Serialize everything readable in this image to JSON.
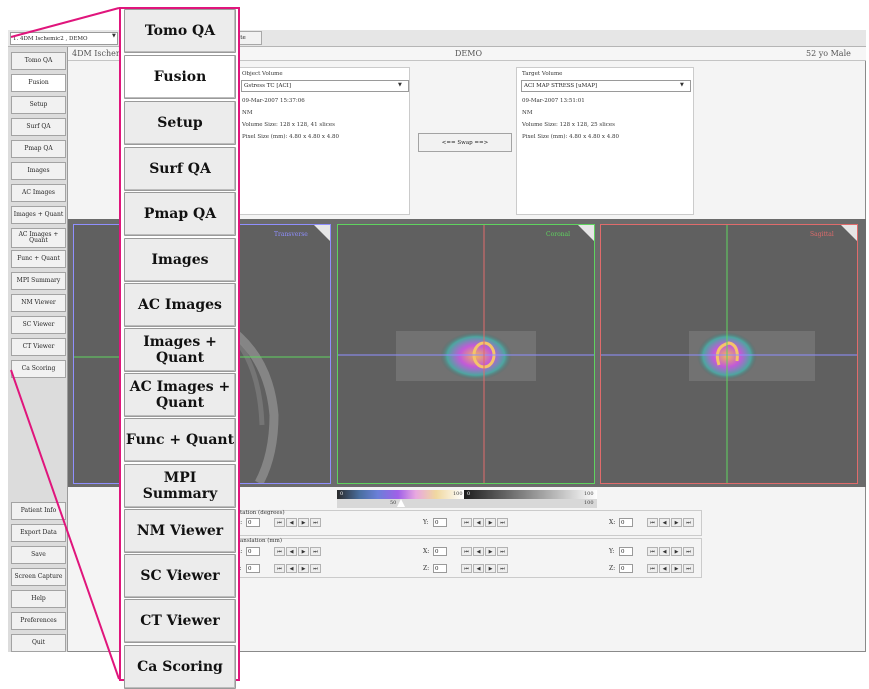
{
  "study": {
    "selected": "1. 4DM Ischemic2 , DEMO",
    "extra_button": "ate"
  },
  "sidebar": {
    "items": [
      {
        "label": "Tomo QA"
      },
      {
        "label": "Fusion"
      },
      {
        "label": "Setup"
      },
      {
        "label": "Surf QA"
      },
      {
        "label": "Pmap QA"
      },
      {
        "label": "Images"
      },
      {
        "label": "AC Images"
      },
      {
        "label": "Images + Quant"
      },
      {
        "label": "AC Images + Quant"
      },
      {
        "label": "Func + Quant"
      },
      {
        "label": "MPI Summary"
      },
      {
        "label": "NM Viewer"
      },
      {
        "label": "SC Viewer"
      },
      {
        "label": "CT Viewer"
      },
      {
        "label": "Ca Scoring"
      }
    ],
    "bottom": [
      {
        "label": "Patient Info"
      },
      {
        "label": "Export Data"
      },
      {
        "label": "Save"
      },
      {
        "label": "Screen Capture"
      },
      {
        "label": "Help"
      },
      {
        "label": "Preferences"
      },
      {
        "label": "Quit"
      }
    ],
    "active": "Fusion"
  },
  "header": {
    "patient": "4DM Ischem",
    "center": "DEMO",
    "age": "52 yo  Male"
  },
  "object_volume": {
    "title": "Object Volume",
    "selected": "Gstress TC [ACI]",
    "date": "09-Mar-2007 15:37:06",
    "modality": "NM",
    "volume_size": "Volume Size: 128 x 128, 41 slices",
    "pixel_size": "Pixel Size (mm): 4.80 x 4.80 x 4.80"
  },
  "target_volume": {
    "title": "Target Volume",
    "selected": "ACI MAP STRESS [uMAP]",
    "date": "09-Mar-2007 13:51:01",
    "modality": "NM",
    "volume_size": "Volume Size: 128 x 128, 25 slices",
    "pixel_size": "Pixel Size (mm): 4.80 x 4.80 x 4.80"
  },
  "swap": {
    "label": "<== Swap ==>"
  },
  "viewports": [
    {
      "label": "Transverse",
      "color": "#8f8fff"
    },
    {
      "label": "Coronal",
      "color": "#5fd35f"
    },
    {
      "label": "Sagittal",
      "color": "#e06b6b"
    }
  ],
  "colorbar": {
    "color_min": "0",
    "color_max": "100",
    "color_mid": "50",
    "gray_min": "0",
    "gray_max": "100",
    "gray_end": "100"
  },
  "rotation": {
    "title": "tation (degrees)",
    "fields": [
      {
        "axis": "Z:",
        "value": "0"
      },
      {
        "axis": "Y:",
        "value": "0"
      },
      {
        "axis": "X:",
        "value": "0"
      }
    ]
  },
  "translation": {
    "title": "anslation (mm)",
    "row1": [
      {
        "axis": "X:",
        "value": "0"
      },
      {
        "axis": "X:",
        "value": "0"
      },
      {
        "axis": "Y:",
        "value": "0"
      }
    ],
    "row2": [
      {
        "axis": "Y:",
        "value": "0"
      },
      {
        "axis": "Z:",
        "value": "0"
      },
      {
        "axis": "Z:",
        "value": "0"
      }
    ]
  },
  "stepper_icons": {
    "first": "⏮",
    "prev": "◀",
    "next": "▶",
    "last": "⏭"
  },
  "callout": {
    "highlight_color": "#e0157c"
  }
}
